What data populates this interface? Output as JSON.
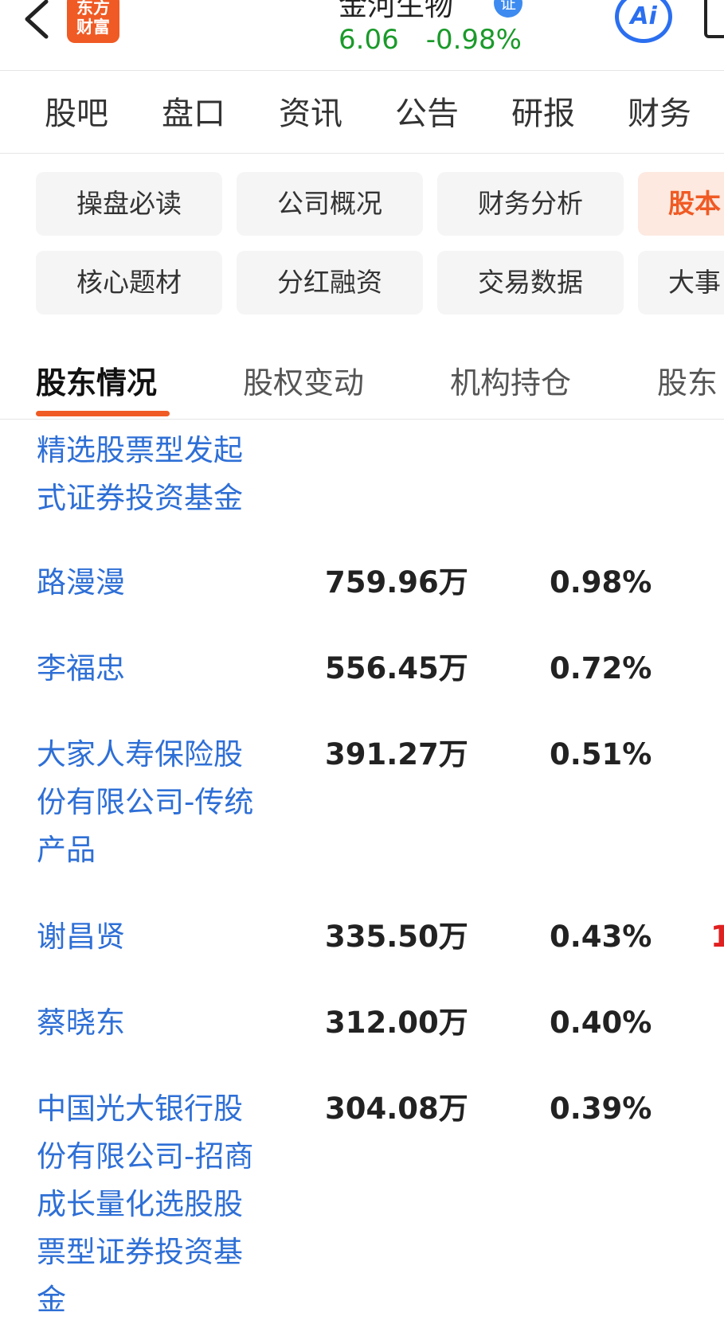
{
  "header": {
    "logo_line1": "东方",
    "logo_line2": "财富",
    "stock_name": "金河生物",
    "verify_badge": "证",
    "price": "6.06",
    "change": "-0.98%",
    "ai_label": "Ai",
    "colors": {
      "up_down": "#1a9a2a",
      "brand": "#f05a24",
      "accent_blue": "#2b6ff0"
    }
  },
  "topnav": [
    "股吧",
    "盘口",
    "资讯",
    "公告",
    "研报",
    "财务"
  ],
  "chips_row1": [
    {
      "label": "操盘必读"
    },
    {
      "label": "公司概况"
    },
    {
      "label": "财务分析"
    },
    {
      "label": "股本",
      "active": true
    }
  ],
  "chips_row2": [
    {
      "label": "核心题材"
    },
    {
      "label": "分红融资"
    },
    {
      "label": "交易数据"
    },
    {
      "label": "大事"
    }
  ],
  "subtabs": [
    "股东情况",
    "股权变动",
    "机构持仓",
    "股东"
  ],
  "shareholders": [
    {
      "name_lines": [
        "精选股票型发起",
        "式证券投资基金"
      ],
      "shares": "",
      "ratio": "",
      "extra": ""
    },
    {
      "name_lines": [
        "路漫漫"
      ],
      "shares": "759.96万",
      "ratio": "0.98%",
      "extra": ""
    },
    {
      "name_lines": [
        "李福忠"
      ],
      "shares": "556.45万",
      "ratio": "0.72%",
      "extra": ""
    },
    {
      "name_lines": [
        "大家人寿保险股",
        "份有限公司-传统",
        "产品"
      ],
      "shares": "391.27万",
      "ratio": "0.51%",
      "extra": ""
    },
    {
      "name_lines": [
        "谢昌贤"
      ],
      "shares": "335.50万",
      "ratio": "0.43%",
      "extra": "1"
    },
    {
      "name_lines": [
        "蔡晓东"
      ],
      "shares": "312.00万",
      "ratio": "0.40%",
      "extra": ""
    },
    {
      "name_lines": [
        "中国光大银行股",
        "份有限公司-招商",
        "成长量化选股股",
        "票型证券投资基",
        "金"
      ],
      "shares": "304.08万",
      "ratio": "0.39%",
      "extra": ""
    }
  ]
}
